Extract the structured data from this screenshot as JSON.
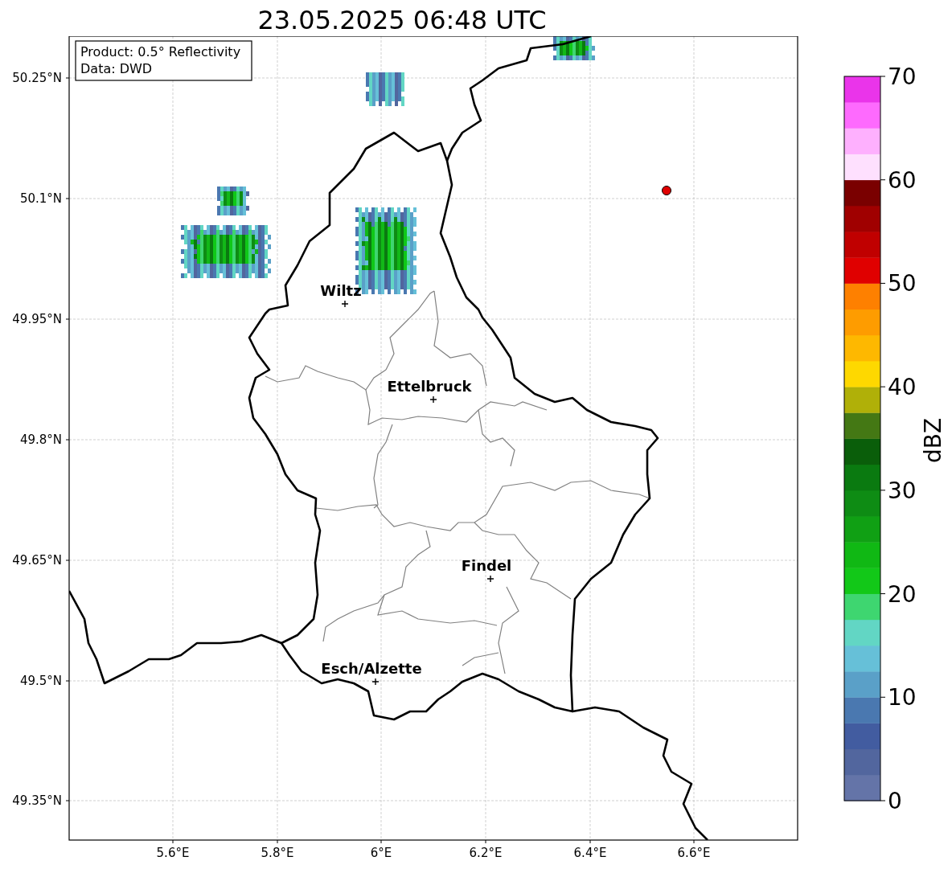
{
  "title": "23.05.2025 06:48 UTC",
  "info_box": {
    "lines": [
      "Product: 0.5° Reflectivity",
      "Data: DWD"
    ]
  },
  "map": {
    "yticks": [
      "50.25°N",
      "50.1°N",
      "49.95°N",
      "49.8°N",
      "49.65°N",
      "49.5°N",
      "49.35°N"
    ],
    "xticks": [
      "5.6°E",
      "5.8°E",
      "6°E",
      "6.2°E",
      "6.4°E",
      "6.6°E"
    ],
    "places": [
      {
        "name": "Wiltz"
      },
      {
        "name": "Ettelbruck"
      },
      {
        "name": "Findel"
      },
      {
        "name": "Esch/Alzette"
      }
    ]
  },
  "colorbar": {
    "label": "dBZ",
    "ticks": [
      "70",
      "60",
      "50",
      "40",
      "30",
      "20",
      "10",
      "0"
    ],
    "bins": [
      {
        "color": "#6474a8"
      },
      {
        "color": "#52669e"
      },
      {
        "color": "#425ca0"
      },
      {
        "color": "#4a78b0"
      },
      {
        "color": "#5aa0c8"
      },
      {
        "color": "#66c0d8"
      },
      {
        "color": "#62d6c4"
      },
      {
        "color": "#3ed670"
      },
      {
        "color": "#12c818"
      },
      {
        "color": "#10b814"
      },
      {
        "color": "#10a014"
      },
      {
        "color": "#0e8c14"
      },
      {
        "color": "#0a7a10"
      },
      {
        "color": "#0a5e0a"
      },
      {
        "color": "#447814"
      },
      {
        "color": "#b0b008"
      },
      {
        "color": "#fed800"
      },
      {
        "color": "#feb800"
      },
      {
        "color": "#fe9c00"
      },
      {
        "color": "#fe8000"
      },
      {
        "color": "#e00000"
      },
      {
        "color": "#c00000"
      },
      {
        "color": "#a00000"
      },
      {
        "color": "#7a0000"
      },
      {
        "color": "#fee0fe"
      },
      {
        "color": "#feb0fe"
      },
      {
        "color": "#fe6afe"
      },
      {
        "color": "#ea34ea"
      }
    ]
  }
}
